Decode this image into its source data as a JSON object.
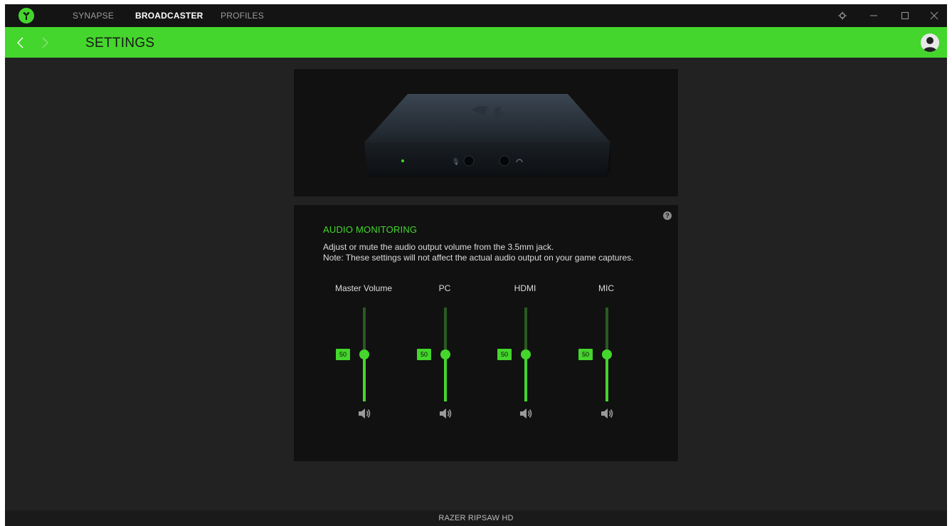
{
  "nav": {
    "tabs": [
      {
        "label": "SYNAPSE",
        "active": false
      },
      {
        "label": "BROADCASTER",
        "active": true
      },
      {
        "label": "PROFILES",
        "active": false
      }
    ]
  },
  "window_controls": [
    "settings-icon",
    "minimize-icon",
    "maximize-icon",
    "close-icon"
  ],
  "header": {
    "title": "SETTINGS",
    "back_icon": "chevron-left-icon",
    "forward_icon": "chevron-right-icon",
    "avatar_icon": "user-icon"
  },
  "audio_monitoring": {
    "title": "AUDIO MONITORING",
    "description_line1": "Adjust or mute the audio output volume from the 3.5mm jack.",
    "description_line2": "Note: These settings will not affect the actual audio output on your game captures.",
    "help_icon": "help-icon",
    "channels": [
      {
        "label": "Master Volume",
        "value": 50,
        "value_text": "50",
        "icon": "speaker-icon"
      },
      {
        "label": "PC",
        "value": 50,
        "value_text": "50",
        "icon": "speaker-icon"
      },
      {
        "label": "HDMI",
        "value": 50,
        "value_text": "50",
        "icon": "speaker-icon"
      },
      {
        "label": "MIC",
        "value": 50,
        "value_text": "50",
        "icon": "speaker-icon"
      }
    ]
  },
  "footer": {
    "device_name": "RAZER RIPSAW HD"
  },
  "colors": {
    "accent": "#44d62c",
    "background": "#222222",
    "panel": "#111111",
    "titlebar": "#141414"
  }
}
